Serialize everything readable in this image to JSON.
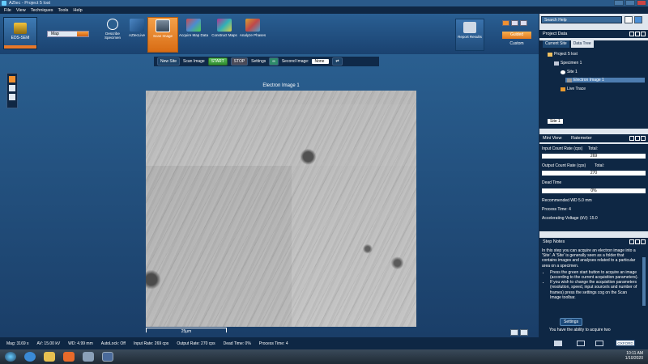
{
  "window": {
    "title": "AZtec - Project 5 lost"
  },
  "menu": [
    "File",
    "View",
    "Techniques",
    "Tools",
    "Help"
  ],
  "ribbon": {
    "technique": "EDS-SEM",
    "mode": "Map",
    "steps": [
      {
        "label": "Describe Specimen",
        "icon": "info-icon",
        "color": "#2b5e8e"
      },
      {
        "label": "AZtecLive",
        "icon": "aztec-live-icon",
        "color": "#4b86c4"
      },
      {
        "label": "Scan Image",
        "icon": "scan-image-icon",
        "color": "#f0902c",
        "active": true
      },
      {
        "label": "Acquire Map Data",
        "icon": "map-icon",
        "color": "#d04c4c"
      },
      {
        "label": "Construct Maps",
        "icon": "construct-maps-icon",
        "color": "#b83090"
      },
      {
        "label": "Analyze Phases",
        "icon": "phases-icon",
        "color": "#d6a030"
      }
    ],
    "report": "Report Results",
    "guided": "Guided",
    "custom": "Custom"
  },
  "toolbar": {
    "new_site": "New Site",
    "scan_image": "Scan Image",
    "start": "START",
    "stop": "STOP",
    "settings": "Settings",
    "second_image": "Second Image:",
    "second_value": "None"
  },
  "image": {
    "title": "Electron Image 1",
    "scale": "25μm"
  },
  "help": {
    "placeholder": "Search Help"
  },
  "project": {
    "heading": "Project Data",
    "tabs": [
      "Current Site",
      "Data Tree"
    ],
    "tree": [
      "Project 5 lost",
      "Specimen 1",
      "Site 1",
      "Electron Image 1",
      "Live Trace"
    ],
    "site": "Site 1"
  },
  "mini": {
    "tabs": [
      "Mini View",
      "Ratemeter"
    ],
    "input_label": "Input Count Rate (cps)",
    "input_total": "Total:",
    "input_value": "269",
    "output_label": "Output Count Rate (cps)",
    "output_total": "Total:",
    "output_value": "270",
    "dead_label": "Dead Time",
    "dead_value": "0%",
    "wd": "Recommended WD 5.0 mm",
    "process": "Process Time: 4",
    "kv": "Accelerating Voltage (kV): 15.0"
  },
  "notes": {
    "heading": "Step Notes",
    "text": "In this step you can acquire an electron image into a 'Site'. A 'Site' is generally seen as a folder that contains images and analyses related to a particular area on a specimen.",
    "bullet1": "Press the green start button to acquire an image (according to the current acquisition parameters).",
    "bullet2": "If you wish to change the acquisition parameters (resolution, speed, input source/s and number of frames) press the settings cog on the Scan Image toolbar.",
    "settings": "Settings",
    "tail": "You have the ability to acquire two"
  },
  "status": {
    "mag": "Mag: 3169 x",
    "kv": "AV: 15.00 kV",
    "wd": "WD: 4.99 mm",
    "autolock": "AutoLock: Off",
    "input": "Input Rate: 269 cps",
    "output": "Output Rate: 270 cps",
    "dead": "Dead Time: 0%",
    "process": "Process Time: 4",
    "brand": "OXFORD"
  },
  "clock": {
    "time": "10:11 AM",
    "date": "1/10/2020"
  }
}
